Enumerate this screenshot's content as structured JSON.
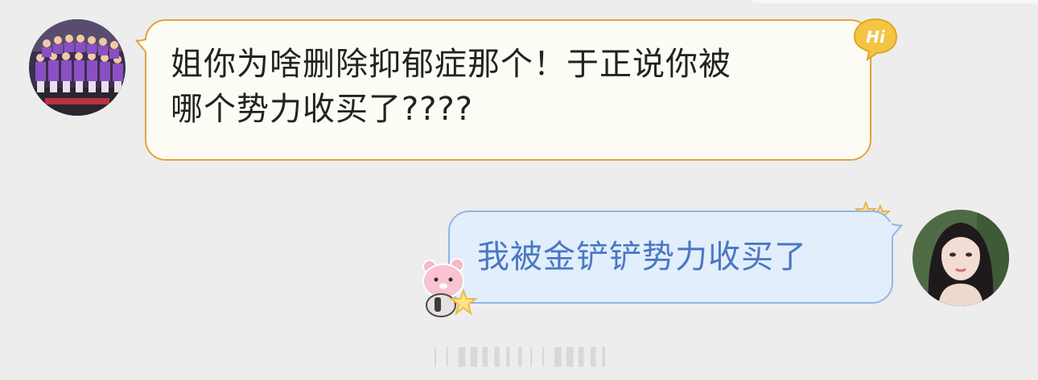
{
  "conversation": {
    "messages": [
      {
        "side": "incoming",
        "lines": [
          "姐你为啥删除抑郁症那个！于正说你被",
          "哪个势力收买了????"
        ]
      },
      {
        "side": "outgoing",
        "lines": [
          "我被金铲铲势力收买了"
        ]
      }
    ]
  },
  "badges": {
    "hi": "Hi"
  },
  "watermark": "▏▏▌▌▍▍▎▎▏▏▌▌▍▍▎▎▏",
  "colors": {
    "background": "#ededed",
    "incoming_bubble": "#fdfcf4",
    "incoming_border": "#e3a33a",
    "outgoing_bubble": "#e2eefc",
    "outgoing_border": "#93b5e6",
    "outgoing_text": "#4a78c2",
    "hi_badge": "#f4c542"
  },
  "icons": {
    "left_avatar": "team-photo-avatar",
    "right_avatar": "woman-portrait-avatar",
    "sticker_top_right": "stars-sticker-icon",
    "sticker_bottom_left": "pink-bear-sticker-icon"
  }
}
